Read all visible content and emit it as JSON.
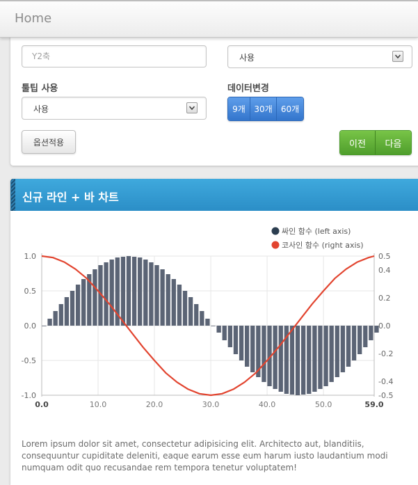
{
  "header": {
    "title": "Home"
  },
  "options": {
    "y2_placeholder": "Y2축",
    "top_right_select": "사용",
    "tooltip_label": "툴팁 사용",
    "tooltip_select": "사용",
    "data_change_label": "데이터변경",
    "data_buttons": [
      "9개",
      "30개",
      "60개"
    ],
    "apply_label": "옵션적용",
    "prev_label": "이전",
    "next_label": "다음"
  },
  "chart_panel": {
    "title": "신규 라인 + 바 차트"
  },
  "colors": {
    "bar": "#5b6475",
    "line": "#e2442f",
    "header": "#359dd3",
    "sine_legend": "#2c3e50"
  },
  "chart_data": {
    "type": "bar",
    "x_range": [
      0,
      59
    ],
    "x_ticks": [
      "0.0",
      "10.0",
      "20.0",
      "30.0",
      "40.0",
      "50.0",
      "59.0"
    ],
    "y_left_ticks": [
      "1.0",
      "0.5",
      "0.0",
      "-0.5",
      "-1.0"
    ],
    "y_right_ticks": [
      "0.5",
      "0.4",
      "0.2",
      "0.0",
      "-0.2",
      "-0.4",
      "-0.5"
    ],
    "ylim_left": [
      -1,
      1
    ],
    "ylim_right": [
      -0.5,
      0.5
    ],
    "grid": true,
    "legend_position": "top-right",
    "series": [
      {
        "name": "싸인 함수 (left axis)",
        "type": "bar",
        "axis": "left",
        "x": [
          0,
          1,
          2,
          3,
          4,
          5,
          6,
          7,
          8,
          9,
          10,
          11,
          12,
          13,
          14,
          15,
          16,
          17,
          18,
          19,
          20,
          21,
          22,
          23,
          24,
          25,
          26,
          27,
          28,
          29,
          30,
          31,
          32,
          33,
          34,
          35,
          36,
          37,
          38,
          39,
          40,
          41,
          42,
          43,
          44,
          45,
          46,
          47,
          48,
          49,
          50,
          51,
          52,
          53,
          54,
          55,
          56,
          57,
          58,
          59
        ],
        "values": [
          0,
          0.1,
          0.21,
          0.31,
          0.41,
          0.5,
          0.59,
          0.67,
          0.74,
          0.81,
          0.87,
          0.91,
          0.95,
          0.98,
          0.99,
          1,
          0.99,
          0.98,
          0.95,
          0.91,
          0.87,
          0.81,
          0.74,
          0.67,
          0.59,
          0.5,
          0.41,
          0.31,
          0.21,
          0.1,
          0,
          -0.1,
          -0.21,
          -0.31,
          -0.41,
          -0.5,
          -0.59,
          -0.67,
          -0.74,
          -0.81,
          -0.87,
          -0.91,
          -0.95,
          -0.98,
          -0.99,
          -1,
          -0.99,
          -0.98,
          -0.95,
          -0.91,
          -0.87,
          -0.81,
          -0.74,
          -0.67,
          -0.59,
          -0.5,
          -0.41,
          -0.31,
          -0.21,
          -0.1
        ]
      },
      {
        "name": "코사인 함수 (right axis)",
        "type": "line",
        "axis": "right",
        "x": [
          0,
          2,
          4,
          6,
          8,
          10,
          12,
          14,
          16,
          18,
          20,
          22,
          24,
          26,
          28,
          30,
          32,
          34,
          36,
          38,
          40,
          42,
          44,
          46,
          48,
          50,
          52,
          54,
          56,
          58,
          59
        ],
        "values": [
          0.5,
          0.489,
          0.457,
          0.406,
          0.339,
          0.25,
          0.156,
          0.052,
          -0.052,
          -0.156,
          -0.25,
          -0.339,
          -0.406,
          -0.457,
          -0.489,
          -0.5,
          -0.489,
          -0.457,
          -0.406,
          -0.339,
          -0.25,
          -0.156,
          -0.052,
          0.052,
          0.156,
          0.25,
          0.339,
          0.406,
          0.457,
          0.489,
          0.5
        ]
      }
    ]
  },
  "description": "Lorem ipsum dolor sit amet, consectetur adipisicing elit. Architecto aut, blanditiis, consequuntur cupiditate deleniti, eaque earum esse eum harum iusto laudantium modi numquam odit quo recusandae rem tempora tenetur voluptatem!"
}
